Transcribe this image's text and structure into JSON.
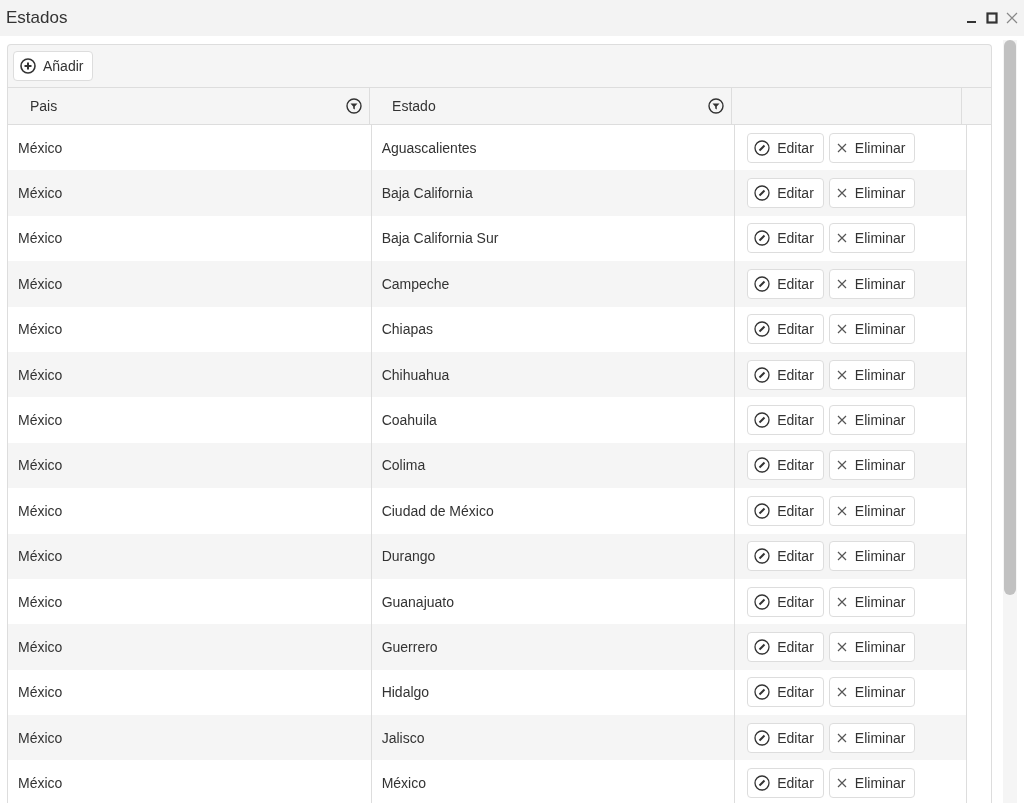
{
  "window": {
    "title": "Estados"
  },
  "toolbar": {
    "add_button": "Añadir"
  },
  "table": {
    "columns": [
      {
        "label": "Pais"
      },
      {
        "label": "Estado"
      }
    ],
    "rows": [
      {
        "pais": "México",
        "estado": "Aguascalientes",
        "edit": "Editar",
        "delete": "Eliminar"
      },
      {
        "pais": "México",
        "estado": "Baja California",
        "edit": "Editar",
        "delete": "Eliminar"
      },
      {
        "pais": "México",
        "estado": "Baja California Sur",
        "edit": "Editar",
        "delete": "Eliminar"
      },
      {
        "pais": "México",
        "estado": "Campeche",
        "edit": "Editar",
        "delete": "Eliminar"
      },
      {
        "pais": "México",
        "estado": "Chiapas",
        "edit": "Editar",
        "delete": "Eliminar"
      },
      {
        "pais": "México",
        "estado": "Chihuahua",
        "edit": "Editar",
        "delete": "Eliminar"
      },
      {
        "pais": "México",
        "estado": "Coahuila",
        "edit": "Editar",
        "delete": "Eliminar"
      },
      {
        "pais": "México",
        "estado": "Colima",
        "edit": "Editar",
        "delete": "Eliminar"
      },
      {
        "pais": "México",
        "estado": "Ciudad de México",
        "edit": "Editar",
        "delete": "Eliminar"
      },
      {
        "pais": "México",
        "estado": "Durango",
        "edit": "Editar",
        "delete": "Eliminar"
      },
      {
        "pais": "México",
        "estado": "Guanajuato",
        "edit": "Editar",
        "delete": "Eliminar"
      },
      {
        "pais": "México",
        "estado": "Guerrero",
        "edit": "Editar",
        "delete": "Eliminar"
      },
      {
        "pais": "México",
        "estado": "Hidalgo",
        "edit": "Editar",
        "delete": "Eliminar"
      },
      {
        "pais": "México",
        "estado": "Jalisco",
        "edit": "Editar",
        "delete": "Eliminar"
      },
      {
        "pais": "México",
        "estado": "México",
        "edit": "Editar",
        "delete": "Eliminar"
      }
    ]
  }
}
